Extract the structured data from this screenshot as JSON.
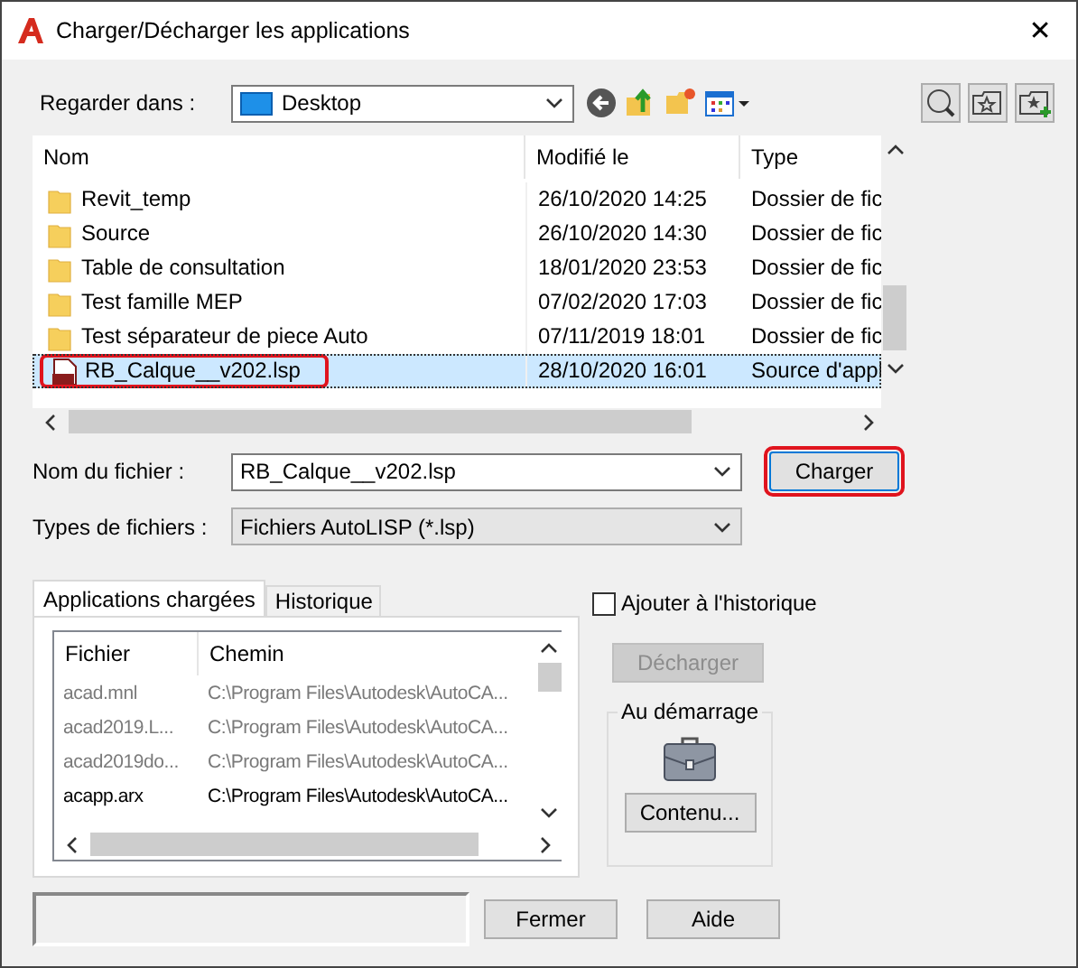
{
  "window": {
    "title": "Charger/Décharger les applications",
    "close": "✕"
  },
  "look_in": {
    "label": "Regarder dans :",
    "value": "Desktop"
  },
  "file_list": {
    "columns": [
      "Nom",
      "Modifié le",
      "Type"
    ],
    "rows": [
      {
        "kind": "folder",
        "name": "Revit_temp",
        "modified": "26/10/2020 14:25",
        "type": "Dossier de fic",
        "selected": false,
        "annotated": false
      },
      {
        "kind": "folder",
        "name": "Source",
        "modified": "26/10/2020 14:30",
        "type": "Dossier de fic",
        "selected": false,
        "annotated": false
      },
      {
        "kind": "folder",
        "name": "Table de consultation",
        "modified": "18/01/2020 23:53",
        "type": "Dossier de fic",
        "selected": false,
        "annotated": false
      },
      {
        "kind": "folder",
        "name": "Test famille MEP",
        "modified": "07/02/2020 17:03",
        "type": "Dossier de fic",
        "selected": false,
        "annotated": false
      },
      {
        "kind": "folder",
        "name": "Test séparateur de piece Auto",
        "modified": "07/11/2019 18:01",
        "type": "Dossier de fic",
        "selected": false,
        "annotated": false
      },
      {
        "kind": "lsp",
        "name": "RB_Calque__v202.lsp",
        "modified": "28/10/2020 16:01",
        "type": "Source d'appl",
        "selected": true,
        "annotated": true
      }
    ]
  },
  "file_name": {
    "label": "Nom du fichier :",
    "value": "RB_Calque__v202.lsp"
  },
  "file_types": {
    "label": "Types de fichiers :",
    "value": "Fichiers AutoLISP (*.lsp)"
  },
  "load_button": {
    "label": "Charger",
    "annotated": true
  },
  "tabs": [
    {
      "label": "Applications chargées",
      "selected": true
    },
    {
      "label": "Historique",
      "selected": false
    }
  ],
  "loaded_apps": {
    "columns": [
      "Fichier",
      "Chemin"
    ],
    "rows": [
      {
        "file": "acad.mnl",
        "path": "C:\\Program Files\\Autodesk\\AutoCA...",
        "greyed": true
      },
      {
        "file": "acad2019.L...",
        "path": "C:\\Program Files\\Autodesk\\AutoCA...",
        "greyed": true
      },
      {
        "file": "acad2019do...",
        "path": "C:\\Program Files\\Autodesk\\AutoCA...",
        "greyed": true
      },
      {
        "file": "acapp.arx",
        "path": "C:\\Program Files\\Autodesk\\AutoCA...",
        "greyed": false
      }
    ]
  },
  "add_to_history": {
    "label": "Ajouter à l'historique",
    "checked": false
  },
  "unload_button": {
    "label": "Décharger",
    "disabled": true
  },
  "startup": {
    "title": "Au démarrage",
    "button": "Contenu..."
  },
  "buttons": [
    "Fermer",
    "Aide"
  ]
}
